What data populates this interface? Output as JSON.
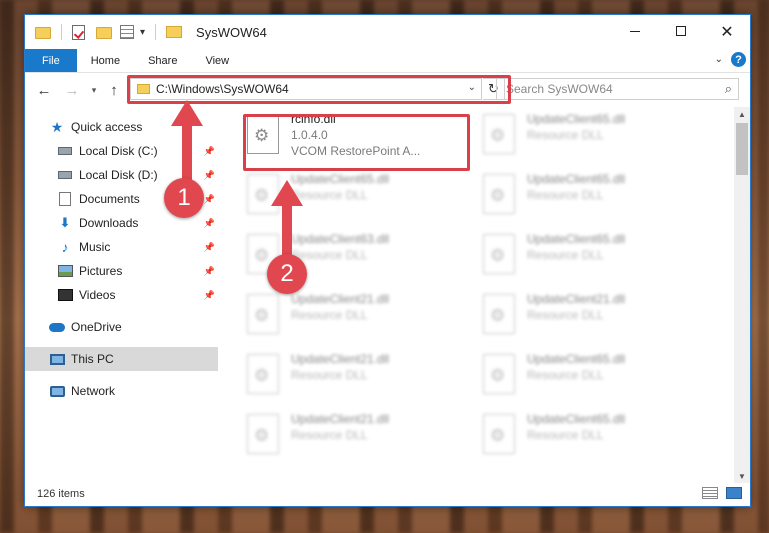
{
  "window": {
    "title": "SysWOW64"
  },
  "ribbon": {
    "tabs": [
      "File",
      "Home",
      "Share",
      "View"
    ]
  },
  "navigation": {
    "address": "C:\\Windows\\SysWOW64",
    "search_placeholder": "Search SysWOW64"
  },
  "sidebar": {
    "items": [
      {
        "label": "Quick access",
        "icon": "star-icon"
      },
      {
        "label": "Local Disk (C:)",
        "icon": "drive-icon",
        "pinned": true
      },
      {
        "label": "Local Disk (D:)",
        "icon": "drive-icon",
        "pinned": true
      },
      {
        "label": "Documents",
        "icon": "documents-icon",
        "pinned": true
      },
      {
        "label": "Downloads",
        "icon": "downloads-icon",
        "pinned": true
      },
      {
        "label": "Music",
        "icon": "music-icon",
        "pinned": true
      },
      {
        "label": "Pictures",
        "icon": "pictures-icon",
        "pinned": true
      },
      {
        "label": "Videos",
        "icon": "videos-icon",
        "pinned": true
      },
      {
        "label": "OneDrive",
        "icon": "cloud-icon"
      },
      {
        "label": "This PC",
        "icon": "pc-icon",
        "selected": true
      },
      {
        "label": "Network",
        "icon": "network-icon"
      }
    ]
  },
  "files": [
    {
      "name": "rcinfo.dll",
      "line2": "1.0.4.0",
      "line3": "VCOM RestorePoint A..."
    },
    {
      "name": "UpdateClient65.dll",
      "line2": "Resource DLL"
    },
    {
      "name": "UpdateClient65.dll",
      "line2": "Resource DLL"
    },
    {
      "name": "UpdateClient65.dll",
      "line2": "Resource DLL"
    },
    {
      "name": "UpdateClient63.dll",
      "line2": "Resource DLL"
    },
    {
      "name": "UpdateClient65.dll",
      "line2": "Resource DLL"
    },
    {
      "name": "UpdateClient21.dll",
      "line2": "Resource DLL"
    },
    {
      "name": "UpdateClient21.dll",
      "line2": "Resource DLL"
    },
    {
      "name": "UpdateClient21.dll",
      "line2": "Resource DLL"
    },
    {
      "name": "UpdateClient65.dll",
      "line2": "Resource DLL"
    },
    {
      "name": "UpdateClient21.dll",
      "line2": "Resource DLL"
    },
    {
      "name": "UpdateClient65.dll",
      "line2": "Resource DLL"
    }
  ],
  "status": {
    "item_count": "126 items"
  },
  "annotations": {
    "step1": "1",
    "step2": "2",
    "color": "#e0474f"
  }
}
